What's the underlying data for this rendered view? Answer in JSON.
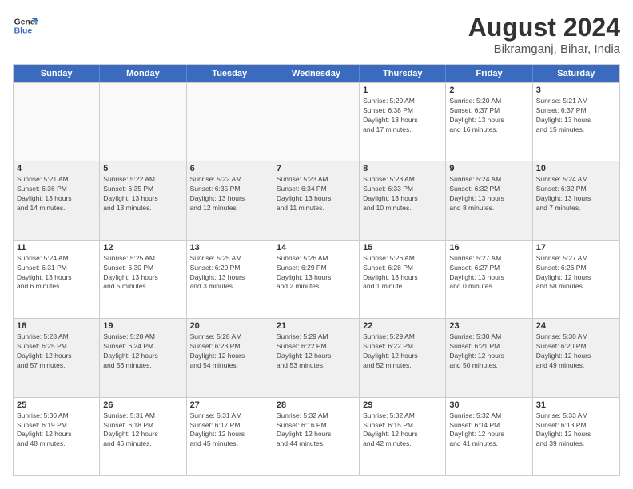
{
  "logo": {
    "line1": "General",
    "line2": "Blue"
  },
  "title": "August 2024",
  "subtitle": "Bikramganj, Bihar, India",
  "days_of_week": [
    "Sunday",
    "Monday",
    "Tuesday",
    "Wednesday",
    "Thursday",
    "Friday",
    "Saturday"
  ],
  "weeks": [
    [
      {
        "day": "",
        "info": ""
      },
      {
        "day": "",
        "info": ""
      },
      {
        "day": "",
        "info": ""
      },
      {
        "day": "",
        "info": ""
      },
      {
        "day": "1",
        "info": "Sunrise: 5:20 AM\nSunset: 6:38 PM\nDaylight: 13 hours\nand 17 minutes."
      },
      {
        "day": "2",
        "info": "Sunrise: 5:20 AM\nSunset: 6:37 PM\nDaylight: 13 hours\nand 16 minutes."
      },
      {
        "day": "3",
        "info": "Sunrise: 5:21 AM\nSunset: 6:37 PM\nDaylight: 13 hours\nand 15 minutes."
      }
    ],
    [
      {
        "day": "4",
        "info": "Sunrise: 5:21 AM\nSunset: 6:36 PM\nDaylight: 13 hours\nand 14 minutes."
      },
      {
        "day": "5",
        "info": "Sunrise: 5:22 AM\nSunset: 6:35 PM\nDaylight: 13 hours\nand 13 minutes."
      },
      {
        "day": "6",
        "info": "Sunrise: 5:22 AM\nSunset: 6:35 PM\nDaylight: 13 hours\nand 12 minutes."
      },
      {
        "day": "7",
        "info": "Sunrise: 5:23 AM\nSunset: 6:34 PM\nDaylight: 13 hours\nand 11 minutes."
      },
      {
        "day": "8",
        "info": "Sunrise: 5:23 AM\nSunset: 6:33 PM\nDaylight: 13 hours\nand 10 minutes."
      },
      {
        "day": "9",
        "info": "Sunrise: 5:24 AM\nSunset: 6:32 PM\nDaylight: 13 hours\nand 8 minutes."
      },
      {
        "day": "10",
        "info": "Sunrise: 5:24 AM\nSunset: 6:32 PM\nDaylight: 13 hours\nand 7 minutes."
      }
    ],
    [
      {
        "day": "11",
        "info": "Sunrise: 5:24 AM\nSunset: 6:31 PM\nDaylight: 13 hours\nand 6 minutes."
      },
      {
        "day": "12",
        "info": "Sunrise: 5:25 AM\nSunset: 6:30 PM\nDaylight: 13 hours\nand 5 minutes."
      },
      {
        "day": "13",
        "info": "Sunrise: 5:25 AM\nSunset: 6:29 PM\nDaylight: 13 hours\nand 3 minutes."
      },
      {
        "day": "14",
        "info": "Sunrise: 5:26 AM\nSunset: 6:29 PM\nDaylight: 13 hours\nand 2 minutes."
      },
      {
        "day": "15",
        "info": "Sunrise: 5:26 AM\nSunset: 6:28 PM\nDaylight: 13 hours\nand 1 minute."
      },
      {
        "day": "16",
        "info": "Sunrise: 5:27 AM\nSunset: 6:27 PM\nDaylight: 13 hours\nand 0 minutes."
      },
      {
        "day": "17",
        "info": "Sunrise: 5:27 AM\nSunset: 6:26 PM\nDaylight: 12 hours\nand 58 minutes."
      }
    ],
    [
      {
        "day": "18",
        "info": "Sunrise: 5:28 AM\nSunset: 6:25 PM\nDaylight: 12 hours\nand 57 minutes."
      },
      {
        "day": "19",
        "info": "Sunrise: 5:28 AM\nSunset: 6:24 PM\nDaylight: 12 hours\nand 56 minutes."
      },
      {
        "day": "20",
        "info": "Sunrise: 5:28 AM\nSunset: 6:23 PM\nDaylight: 12 hours\nand 54 minutes."
      },
      {
        "day": "21",
        "info": "Sunrise: 5:29 AM\nSunset: 6:22 PM\nDaylight: 12 hours\nand 53 minutes."
      },
      {
        "day": "22",
        "info": "Sunrise: 5:29 AM\nSunset: 6:22 PM\nDaylight: 12 hours\nand 52 minutes."
      },
      {
        "day": "23",
        "info": "Sunrise: 5:30 AM\nSunset: 6:21 PM\nDaylight: 12 hours\nand 50 minutes."
      },
      {
        "day": "24",
        "info": "Sunrise: 5:30 AM\nSunset: 6:20 PM\nDaylight: 12 hours\nand 49 minutes."
      }
    ],
    [
      {
        "day": "25",
        "info": "Sunrise: 5:30 AM\nSunset: 6:19 PM\nDaylight: 12 hours\nand 48 minutes."
      },
      {
        "day": "26",
        "info": "Sunrise: 5:31 AM\nSunset: 6:18 PM\nDaylight: 12 hours\nand 46 minutes."
      },
      {
        "day": "27",
        "info": "Sunrise: 5:31 AM\nSunset: 6:17 PM\nDaylight: 12 hours\nand 45 minutes."
      },
      {
        "day": "28",
        "info": "Sunrise: 5:32 AM\nSunset: 6:16 PM\nDaylight: 12 hours\nand 44 minutes."
      },
      {
        "day": "29",
        "info": "Sunrise: 5:32 AM\nSunset: 6:15 PM\nDaylight: 12 hours\nand 42 minutes."
      },
      {
        "day": "30",
        "info": "Sunrise: 5:32 AM\nSunset: 6:14 PM\nDaylight: 12 hours\nand 41 minutes."
      },
      {
        "day": "31",
        "info": "Sunrise: 5:33 AM\nSunset: 6:13 PM\nDaylight: 12 hours\nand 39 minutes."
      }
    ]
  ]
}
